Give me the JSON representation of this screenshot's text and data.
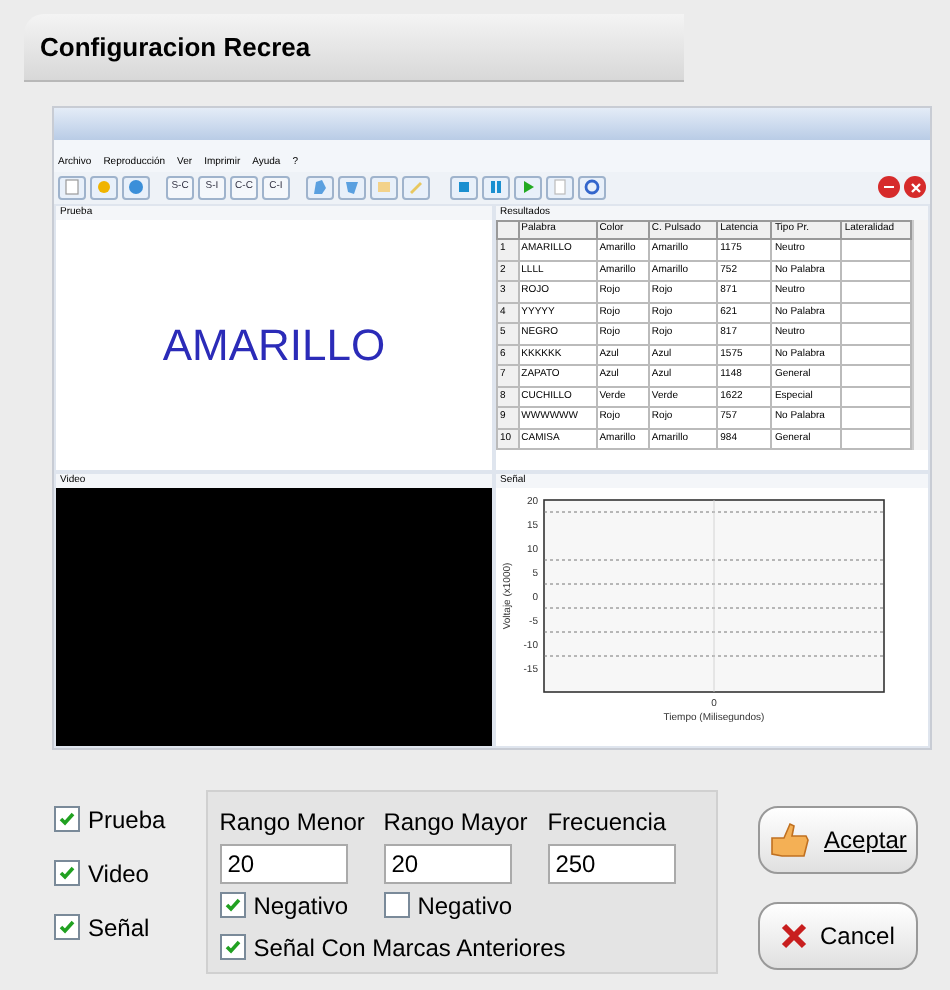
{
  "window": {
    "title": "Configuracion Recrea"
  },
  "menu": [
    "Archivo",
    "Reproducción",
    "Ver",
    "Imprimir",
    "Ayuda",
    "?"
  ],
  "toolbar": {
    "text_buttons": [
      "S-C",
      "S-I",
      "C-C",
      "C-I"
    ]
  },
  "prueba": {
    "title": "Prueba",
    "word": "AMARILLO"
  },
  "resultados": {
    "title": "Resultados",
    "columns": [
      "",
      "Palabra",
      "Color",
      "C. Pulsado",
      "Latencia",
      "Tipo Pr.",
      "Lateralidad"
    ],
    "rows": [
      [
        "1",
        "AMARILLO",
        "Amarillo",
        "Amarillo",
        "1175",
        "Neutro",
        ""
      ],
      [
        "2",
        "LLLL",
        "Amarillo",
        "Amarillo",
        "752",
        "No Palabra",
        ""
      ],
      [
        "3",
        "ROJO",
        "Rojo",
        "Rojo",
        "871",
        "Neutro",
        ""
      ],
      [
        "4",
        "YYYYY",
        "Rojo",
        "Rojo",
        "621",
        "No Palabra",
        ""
      ],
      [
        "5",
        "NEGRO",
        "Rojo",
        "Rojo",
        "817",
        "Neutro",
        ""
      ],
      [
        "6",
        "KKKKKK",
        "Azul",
        "Azul",
        "1575",
        "No Palabra",
        ""
      ],
      [
        "7",
        "ZAPATO",
        "Azul",
        "Azul",
        "1148",
        "General",
        ""
      ],
      [
        "8",
        "CUCHILLO",
        "Verde",
        "Verde",
        "1622",
        "Especial",
        ""
      ],
      [
        "9",
        "WWWWWW",
        "Rojo",
        "Rojo",
        "757",
        "No Palabra",
        ""
      ],
      [
        "10",
        "CAMISA",
        "Amarillo",
        "Amarillo",
        "984",
        "General",
        ""
      ]
    ]
  },
  "video": {
    "title": "Video"
  },
  "senal": {
    "title": "Señal",
    "plot": {
      "xlabel": "Tiempo (Milisegundos)",
      "ylabel": "Voltaje (x1000)",
      "y_tick_labels": [
        "20",
        "15",
        "10",
        "5",
        "0",
        "-5",
        "-10",
        "-15"
      ],
      "x_tick_labels": [
        "0"
      ]
    }
  },
  "options": [
    {
      "label": "Prueba",
      "checked": true
    },
    {
      "label": "Video",
      "checked": true
    },
    {
      "label": "Señal",
      "checked": true
    }
  ],
  "settings": {
    "fields": [
      {
        "label": "Rango Menor",
        "value": "20",
        "negativo": {
          "label": "Negativo",
          "checked": true
        }
      },
      {
        "label": "Rango Mayor",
        "value": "20",
        "negativo": {
          "label": "Negativo",
          "checked": false
        }
      },
      {
        "label": "Frecuencia",
        "value": "250"
      }
    ],
    "marcas": {
      "label": "Señal Con Marcas Anteriores",
      "checked": true
    }
  },
  "buttons": [
    {
      "kind": "accept",
      "label": "Aceptar"
    },
    {
      "kind": "cancel",
      "label": "Cancel"
    }
  ]
}
